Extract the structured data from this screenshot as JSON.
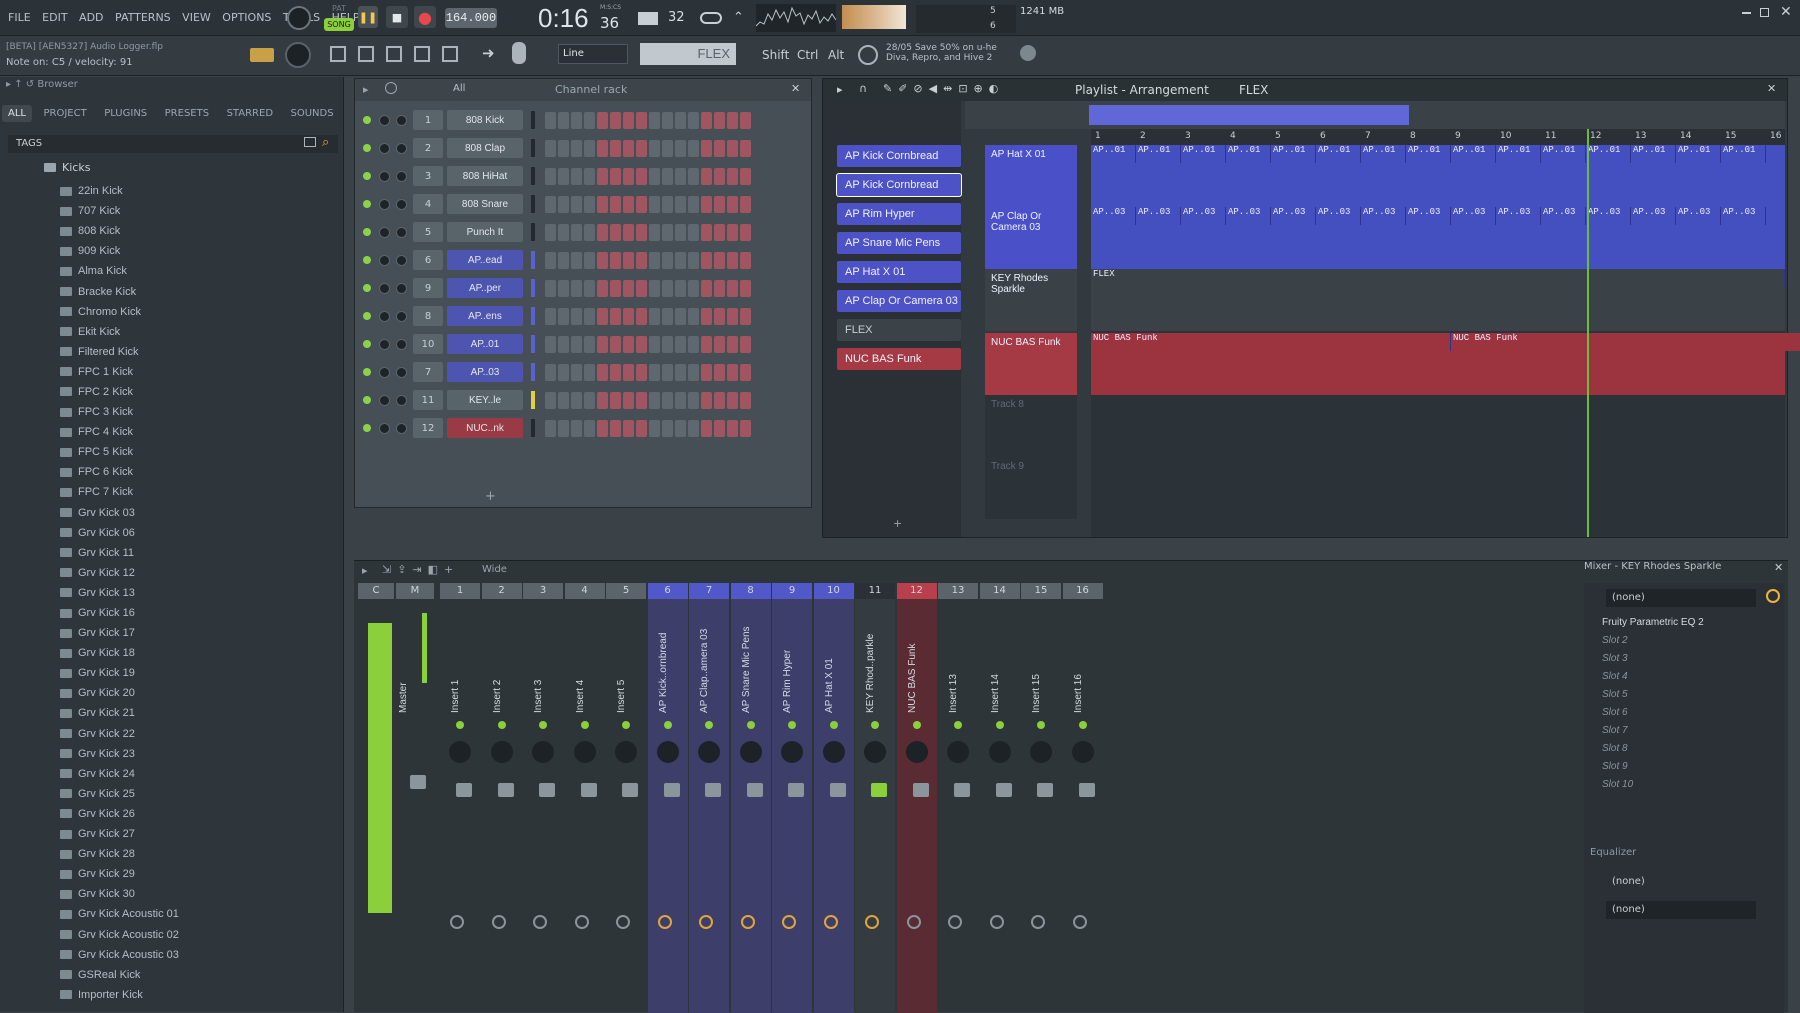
{
  "app": {
    "menu": [
      "FILE",
      "EDIT",
      "ADD",
      "PATTERNS",
      "VIEW",
      "OPTIONS",
      "TOOLS",
      "HELP"
    ],
    "song_badge": "SONG",
    "pat_badge": "PAT",
    "tempo": "164.000",
    "time": "0:16",
    "time_sub": "36",
    "time_unit": "M:S:CS",
    "meter": "32",
    "memory": "1241 MB",
    "cpu_value": "5",
    "polyphony": "6",
    "project_title": "[BETA] [AEN5327] Audio Logger.flp",
    "hint": "Note on: C5 / velocity: 91",
    "snap": "Line",
    "pattern": "FLEX",
    "shift": "Shift",
    "ctrl": "Ctrl",
    "alt": "Alt",
    "news_date": "28/05",
    "news_line1": "Save 50% on u-he",
    "news_line2": "Diva, Repro, and Hive 2"
  },
  "browser": {
    "title": "Browser",
    "tabs": [
      "ALL",
      "PROJECT",
      "PLUGINS",
      "PRESETS",
      "STARRED",
      "SOUNDS"
    ],
    "tags": "TAGS",
    "folder": "Kicks",
    "items": [
      "22in Kick",
      "707 Kick",
      "808 Kick",
      "909 Kick",
      "Alma Kick",
      "Bracke Kick",
      "Chromo Kick",
      "Ekit Kick",
      "Filtered Kick",
      "FPC 1 Kick",
      "FPC 2 Kick",
      "FPC 3 Kick",
      "FPC 4 Kick",
      "FPC 5 Kick",
      "FPC 6 Kick",
      "FPC 7 Kick",
      "Grv Kick 03",
      "Grv Kick 06",
      "Grv Kick 11",
      "Grv Kick 12",
      "Grv Kick 13",
      "Grv Kick 16",
      "Grv Kick 17",
      "Grv Kick 18",
      "Grv Kick 19",
      "Grv Kick 20",
      "Grv Kick 21",
      "Grv Kick 22",
      "Grv Kick 23",
      "Grv Kick 24",
      "Grv Kick 25",
      "Grv Kick 26",
      "Grv Kick 27",
      "Grv Kick 28",
      "Grv Kick 29",
      "Grv Kick 30",
      "Grv Kick Acoustic 01",
      "Grv Kick Acoustic 02",
      "Grv Kick Acoustic 03",
      "GSReal Kick",
      "Importer Kick"
    ]
  },
  "channel_rack": {
    "title": "Channel rack",
    "filter": "All",
    "rows": [
      {
        "num": "1",
        "name": "808 Kick",
        "color": "gray"
      },
      {
        "num": "2",
        "name": "808 Clap",
        "color": "gray"
      },
      {
        "num": "3",
        "name": "808 HiHat",
        "color": "gray"
      },
      {
        "num": "4",
        "name": "808 Snare",
        "color": "gray"
      },
      {
        "num": "5",
        "name": "Punch It",
        "color": "gray"
      },
      {
        "num": "6",
        "name": "AP..ead",
        "color": "blue"
      },
      {
        "num": "9",
        "name": "AP..per",
        "color": "blue"
      },
      {
        "num": "8",
        "name": "AP..ens",
        "color": "blue"
      },
      {
        "num": "10",
        "name": "AP..01",
        "color": "blue"
      },
      {
        "num": "7",
        "name": "AP..03",
        "color": "blue"
      },
      {
        "num": "11",
        "name": "KEY..le",
        "color": "gray"
      },
      {
        "num": "12",
        "name": "NUC..nk",
        "color": "red"
      }
    ]
  },
  "playlist": {
    "title": "Playlist - Arrangement",
    "pattern": "FLEX",
    "picker": [
      "AP Kick Cornbread",
      "AP Kick Cornbread",
      "AP Rim Hyper",
      "AP Snare Mic Pens",
      "AP Hat X 01",
      "AP Clap Or Camera 03",
      "FLEX",
      "NUC BAS Funk"
    ],
    "tracks": [
      "AP Hat X 01",
      "AP Clap Or Camera 03",
      "KEY Rhodes Sparkle",
      "NUC BAS Funk",
      "Track 8",
      "Track 9"
    ],
    "bars": [
      "1",
      "2",
      "3",
      "4",
      "5",
      "6",
      "7",
      "8",
      "9",
      "10",
      "11",
      "12",
      "13",
      "14",
      "15",
      "16"
    ],
    "clip_hat": "AP..01",
    "clip_clap": "AP..03",
    "clip_flex": "FLEX",
    "clip_funk": "NUC BAS Funk"
  },
  "mixer": {
    "title": "Mixer - KEY Rhodes Sparkle",
    "view": "Wide",
    "master_label": "Master",
    "strips": [
      {
        "n": "1",
        "label": "Insert 1"
      },
      {
        "n": "2",
        "label": "Insert 2"
      },
      {
        "n": "3",
        "label": "Insert 3"
      },
      {
        "n": "4",
        "label": "Insert 4"
      },
      {
        "n": "5",
        "label": "Insert 5"
      },
      {
        "n": "6",
        "label": "AP Kick..ornbread"
      },
      {
        "n": "7",
        "label": "AP Clap..amera 03"
      },
      {
        "n": "8",
        "label": "AP Snare Mic Pens"
      },
      {
        "n": "9",
        "label": "AP Rim Hyper"
      },
      {
        "n": "10",
        "label": "AP Hat X 01"
      },
      {
        "n": "11",
        "label": "KEY Rhod..parkle"
      },
      {
        "n": "12",
        "label": "NUC BAS Funk"
      },
      {
        "n": "13",
        "label": "Insert 13"
      },
      {
        "n": "14",
        "label": "Insert 14"
      },
      {
        "n": "15",
        "label": "Insert 15"
      },
      {
        "n": "16",
        "label": "Insert 16"
      }
    ],
    "input": "(none)",
    "slots": [
      "Fruity Parametric EQ 2",
      "Slot 2",
      "Slot 3",
      "Slot 4",
      "Slot 5",
      "Slot 6",
      "Slot 7",
      "Slot 8",
      "Slot 9",
      "Slot 10"
    ],
    "eq_label": "Equalizer",
    "out1": "(none)",
    "out2": "(none)"
  }
}
